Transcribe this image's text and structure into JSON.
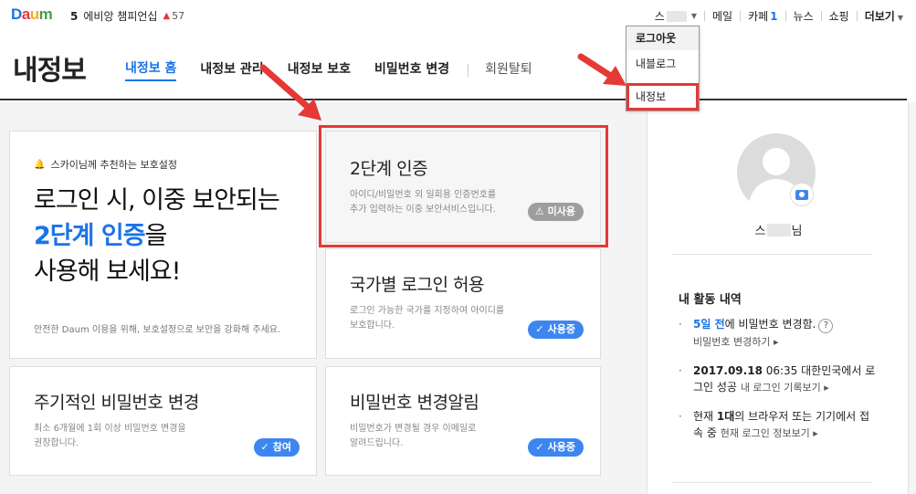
{
  "logo": {
    "text_1": "D",
    "text_2": "a",
    "text_3": "u",
    "text_4": "m"
  },
  "issue": {
    "rank": "5",
    "title": "에비앙 챔피언십",
    "trend_icon": "▲",
    "trend_value": "57"
  },
  "gnb": {
    "user_initial": "스",
    "mail": "메일",
    "cafe": "카페",
    "cafe_count": "1",
    "news": "뉴스",
    "shopping": "쇼핑",
    "more": "더보기"
  },
  "dropdown": {
    "logout": "로그아웃",
    "my_blog": "내블로그",
    "my_info": "내정보"
  },
  "header": {
    "title": "내정보",
    "tabs": [
      {
        "label": "내정보 홈"
      },
      {
        "label": "내정보 관리"
      },
      {
        "label": "내정보 보호"
      },
      {
        "label": "비밀번호 변경"
      },
      {
        "label": "회원탈퇴"
      }
    ]
  },
  "hero": {
    "recommend": "스카이님께 추천하는 보호설정",
    "line1": "로그인 시, 이중 보안되는",
    "line2_blue": "2단계 인증",
    "line2_rest": "을",
    "line3": "사용해 보세요!",
    "footer": "안전한 Daum 이용을 위해, 보호설정으로 보안을 강화해 주세요."
  },
  "services": {
    "twofa": {
      "title": "2단계 인증",
      "desc_1": "아이디/비밀번호 외 일회용 인증번호를",
      "desc_2": "추가 입력하는 이중 보안서비스입니다.",
      "badge": "미사용"
    },
    "country": {
      "title": "국가별 로그인 허용",
      "desc_1": "로그인 가능한 국가를 지정하여 아이디를",
      "desc_2": "보호합니다.",
      "badge": "사용중"
    },
    "pwchange": {
      "title": "주기적인 비밀번호 변경",
      "desc_1": "최소 6개월에 1회 이상 비밀번호 변경을",
      "desc_2": "권장합니다.",
      "badge": "참여"
    },
    "pwalert": {
      "title": "비밀번호 변경알림",
      "desc_1": "비밀번호가 변경될 경우 이메일로",
      "desc_2": "알려드립니다.",
      "badge": "사용중"
    }
  },
  "side": {
    "nick_initial": "스",
    "nick_suffix": "님",
    "activity_title": "내 활동 내역",
    "activity": [
      {
        "highlight": "5일 전",
        "text": "에 비밀번호 변경함.",
        "help": "?",
        "link": "비밀번호 변경하기"
      },
      {
        "date": "2017.09.18",
        "text": " 06:35 대한민국에서 로그인 성공",
        "link": "내 로그인 기록보기"
      },
      {
        "pre": "현재 ",
        "count": "1대",
        "text": "의 브라우저 또는 기기에서 접속 중",
        "link": "현재 로그인 정보보기"
      }
    ]
  },
  "colors": {
    "accent": "#1a73e8",
    "annotation_red": "#e53935",
    "badge_blue": "#3d86f0",
    "badge_grey": "#9e9e9e"
  }
}
